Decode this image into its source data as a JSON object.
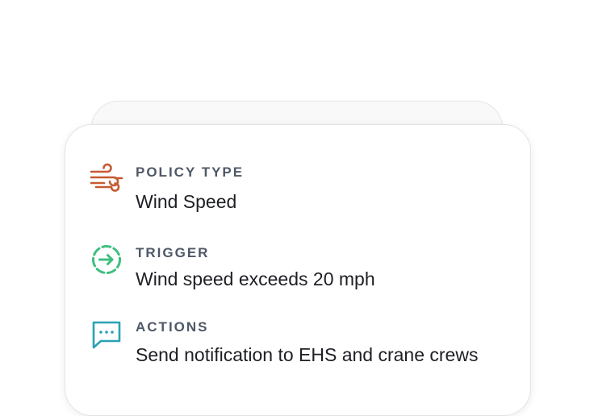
{
  "colors": {
    "policy_icon": "#c65a33",
    "trigger_icon": "#3ebf7f",
    "actions_icon": "#2aa1b3",
    "label": "#4f5866",
    "value": "#1d1f24"
  },
  "policy": {
    "icon": "wind-icon",
    "label": "POLICY TYPE",
    "value": "Wind Speed"
  },
  "trigger": {
    "icon": "trigger-arrow-icon",
    "label": "TRIGGER",
    "value": "Wind speed exceeds 20 mph"
  },
  "actions": {
    "icon": "chat-bubble-icon",
    "label": "ACTIONS",
    "value": "Send notification to EHS and crane crews"
  }
}
